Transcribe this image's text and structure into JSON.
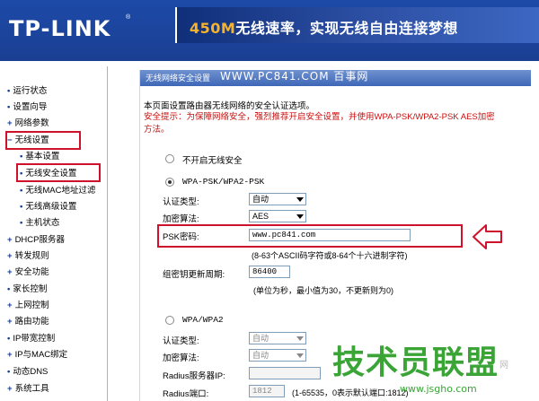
{
  "header": {
    "logo": "TP-LINK",
    "logo_reg": "®",
    "banner_hl": "450M",
    "banner_rest": "无线速率，实现无线自由连接梦想",
    "brand_color": "#1d4aa8"
  },
  "sidebar": {
    "items": [
      {
        "label": "运行状态",
        "sub": false
      },
      {
        "label": "设置向导",
        "sub": false
      },
      {
        "label": "网络参数",
        "sub": false
      },
      {
        "label": "无线设置",
        "sub": false,
        "selected": true
      },
      {
        "label": "基本设置",
        "sub": true
      },
      {
        "label": "无线安全设置",
        "sub": true,
        "selected": true
      },
      {
        "label": "无线MAC地址过滤",
        "sub": true
      },
      {
        "label": "无线高级设置",
        "sub": true
      },
      {
        "label": "主机状态",
        "sub": true
      },
      {
        "label": "DHCP服务器",
        "sub": false
      },
      {
        "label": "转发规则",
        "sub": false
      },
      {
        "label": "安全功能",
        "sub": false
      },
      {
        "label": "家长控制",
        "sub": false
      },
      {
        "label": "上网控制",
        "sub": false
      },
      {
        "label": "路由功能",
        "sub": false
      },
      {
        "label": "IP带宽控制",
        "sub": false
      },
      {
        "label": "IP与MAC绑定",
        "sub": false
      },
      {
        "label": "动态DNS",
        "sub": false
      },
      {
        "label": "系统工具",
        "sub": false
      }
    ]
  },
  "content": {
    "title": "无线网络安全设置",
    "watermark": "WWW.PC841.COM 百事网",
    "description": "本页面设置路由器无线网络的安全认证选项。",
    "warning": "安全提示：为保障网络安全，强烈推荐开启安全设置，并使用WPA-PSK/WPA2-PSK AES加密方法。",
    "option_none": "不开启无线安全",
    "option_wpa_psk": "WPA-PSK/WPA2-PSK",
    "auth_type_label": "认证类型:",
    "auth_type_value": "自动",
    "encrypt_label": "加密算法:",
    "encrypt_value": "AES",
    "psk_label": "PSK密码:",
    "psk_value": "www.pc841.com",
    "psk_hint": "(8-63个ASCII码字符或8-64个十六进制字符)",
    "group_key_label": "组密钥更新周期:",
    "group_key_value": "86400",
    "group_key_hint": "(单位为秒，最小值为30，不更新则为0)",
    "option_wpa": "WPA/WPA2",
    "wpa_auth_label": "认证类型:",
    "wpa_auth_value": "自动",
    "wpa_encrypt_label": "加密算法:",
    "wpa_encrypt_value": "自动",
    "radius_ip_label": "Radius服务器IP:",
    "radius_port_label": "Radius端口:",
    "radius_port_value": "1812",
    "radius_port_hint": "(1-65535，0表示默认端口:1812)"
  },
  "overlay": {
    "jsgho_text": "技术员联盟",
    "jsgho_url": "www.jsgho.com",
    "jsgho_side": "网"
  },
  "colors": {
    "highlight_red": "#d0112b",
    "warning_text": "#c91010",
    "brand_green": "#3aa436"
  }
}
